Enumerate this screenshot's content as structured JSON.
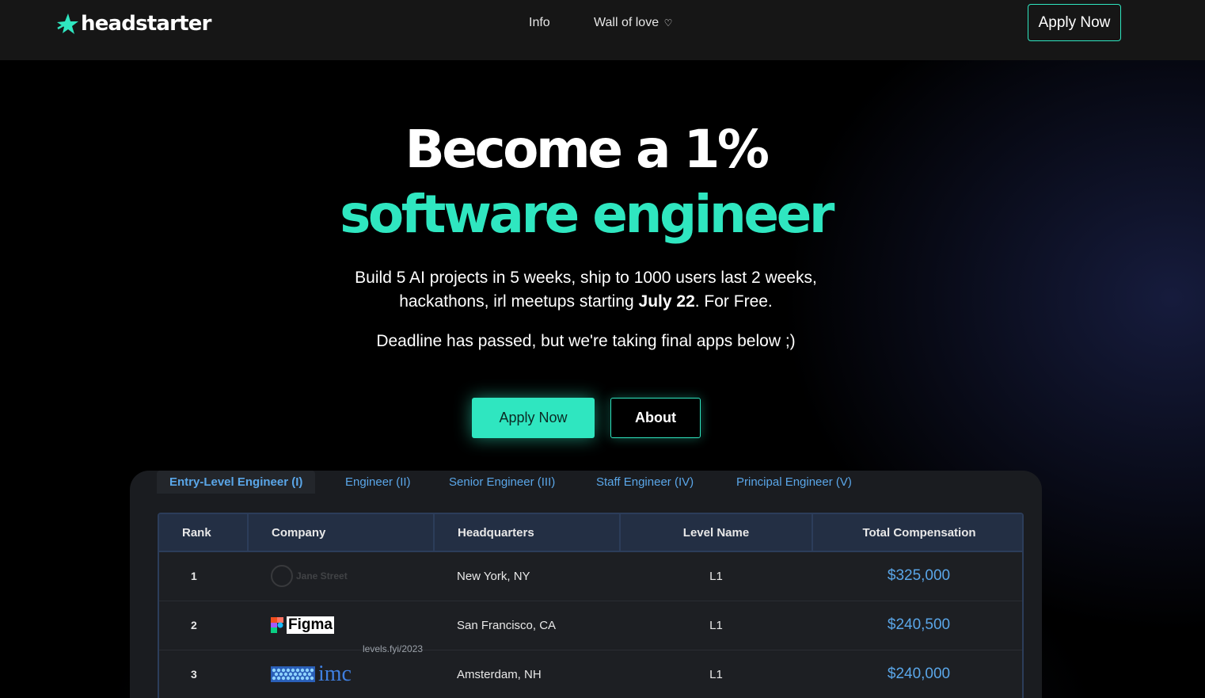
{
  "nav": {
    "brand": "headstarter",
    "links": [
      "Info",
      "Wall of love"
    ],
    "heart_icon": "heart-icon",
    "cta": "Apply Now"
  },
  "hero": {
    "title_line1": "Become a 1%",
    "title_line2": "software engineer",
    "sub_part1": "Build 5 AI projects in 5 weeks, ship to 1000 users last 2 weeks, hackathons, irl meetups starting ",
    "sub_bold": "July 22",
    "sub_part2": ". For Free.",
    "deadline": "Deadline has passed, but we're taking final apps below ;)",
    "apply_button": "Apply Now",
    "about_button": "About"
  },
  "colors": {
    "accent": "#2fe6c0",
    "link_blue": "#5aa6e8",
    "background": "#000000"
  },
  "levels": {
    "tabs": [
      "Entry-Level Engineer (I)",
      "Engineer (II)",
      "Senior Engineer (III)",
      "Staff Engineer (IV)",
      "Principal Engineer (V)"
    ],
    "active_tab": "Entry-Level Engineer (I)",
    "columns": [
      "Rank",
      "Company",
      "Headquarters",
      "Level Name",
      "Total Compensation"
    ],
    "rows": [
      {
        "rank": "1",
        "company": "Jane Street",
        "hq": "New York, NY",
        "level": "L1",
        "comp": "$325,000"
      },
      {
        "rank": "2",
        "company": "Figma",
        "hq": "San Francisco, CA",
        "level": "L1",
        "comp": "$240,500"
      },
      {
        "rank": "3",
        "company": "IMC",
        "hq": "Amsterdam, NH",
        "level": "L1",
        "comp": "$240,000"
      }
    ],
    "company_logo_text": [
      "Jane Street",
      "Figma",
      "imc"
    ],
    "watermark": "levels.fyi/2023"
  }
}
